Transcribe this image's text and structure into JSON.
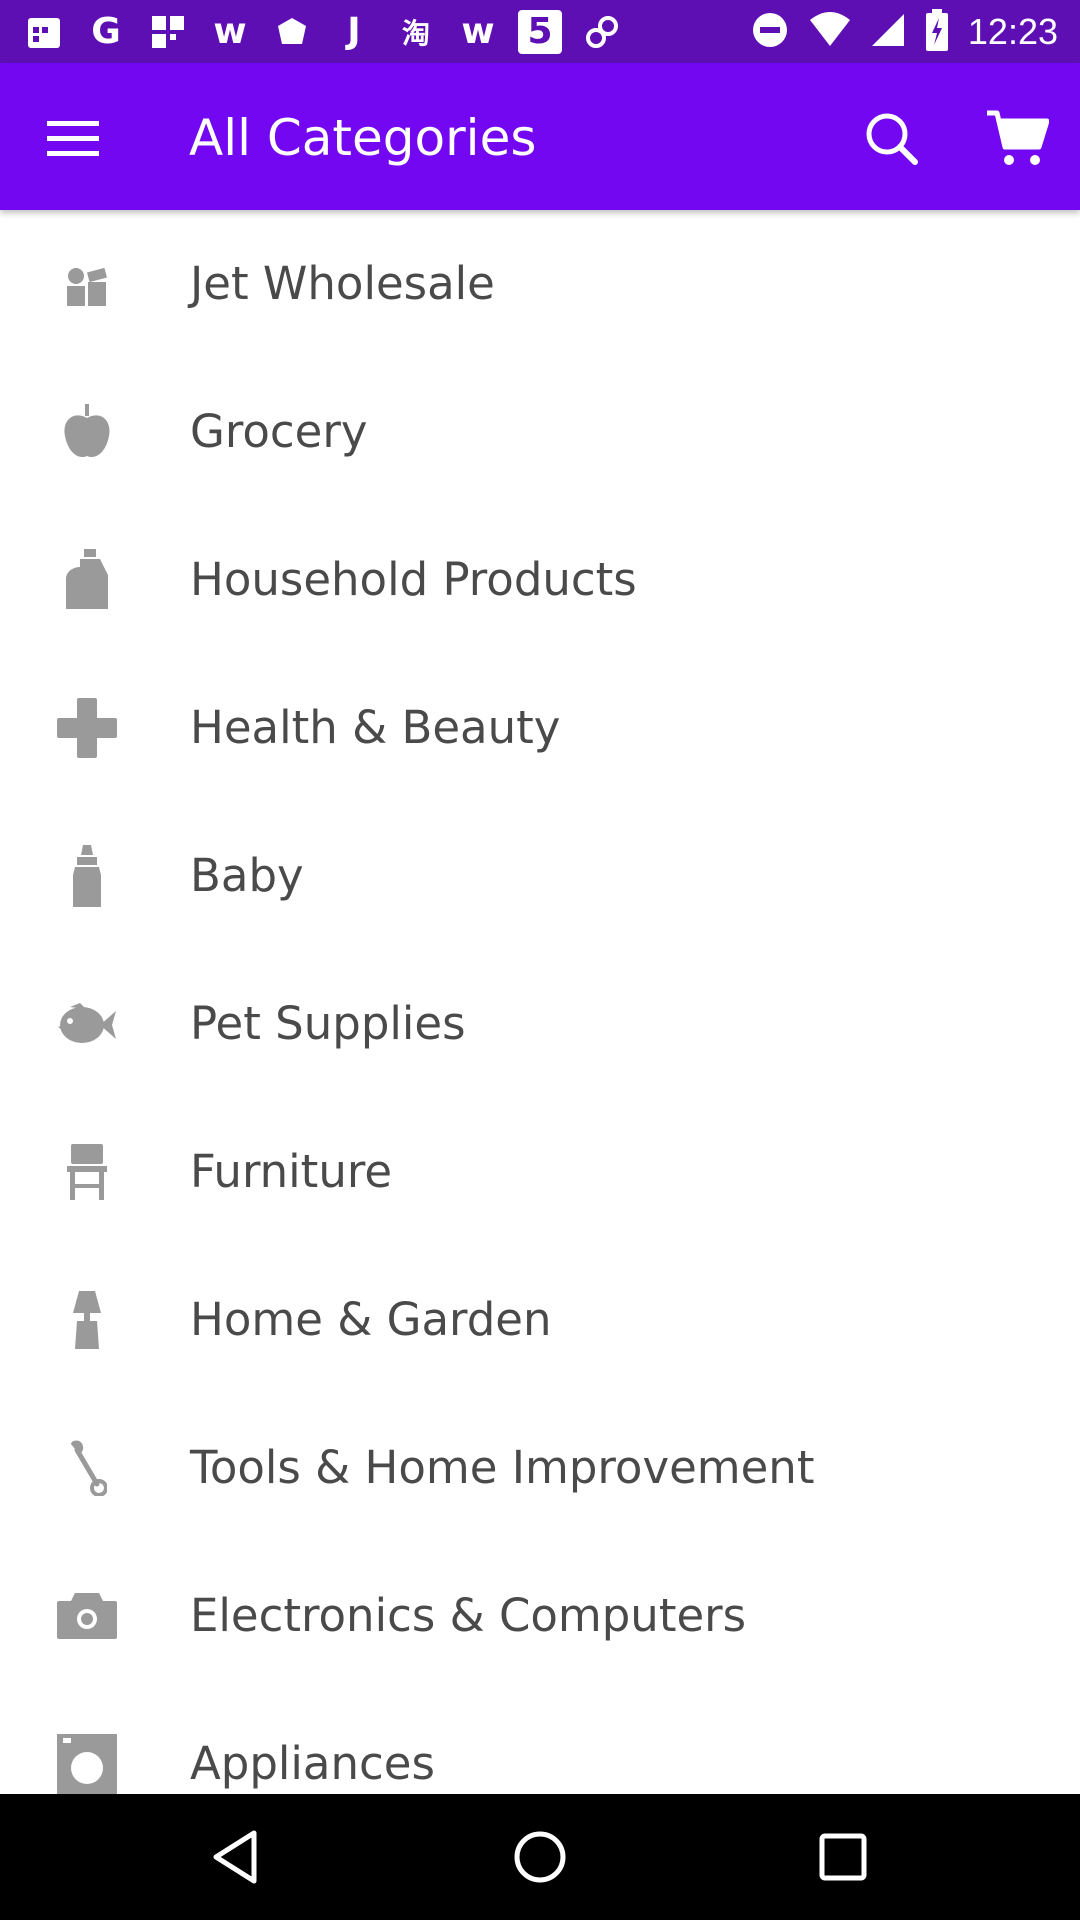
{
  "status_bar": {
    "time": "12:23",
    "notifications": [
      "G",
      "w",
      "J",
      "淘",
      "w",
      "5"
    ]
  },
  "app_bar": {
    "title": "All Categories"
  },
  "colors": {
    "status_bar": "#5e0fb4",
    "app_bar": "#7407f2",
    "icon_gray": "#9a9a9a",
    "label_text": "#4a4a4a"
  },
  "categories": [
    {
      "label": "Jet Wholesale",
      "icon": "wholesale-icon"
    },
    {
      "label": "Grocery",
      "icon": "apple-icon"
    },
    {
      "label": "Household Products",
      "icon": "detergent-bottle-icon"
    },
    {
      "label": "Health & Beauty",
      "icon": "medical-cross-icon"
    },
    {
      "label": "Baby",
      "icon": "baby-bottle-icon"
    },
    {
      "label": "Pet Supplies",
      "icon": "fish-icon"
    },
    {
      "label": "Furniture",
      "icon": "chair-icon"
    },
    {
      "label": "Home & Garden",
      "icon": "lamp-icon"
    },
    {
      "label": "Tools & Home Improvement",
      "icon": "wrench-icon"
    },
    {
      "label": "Electronics & Computers",
      "icon": "camera-icon"
    },
    {
      "label": "Appliances",
      "icon": "washing-machine-icon"
    }
  ]
}
